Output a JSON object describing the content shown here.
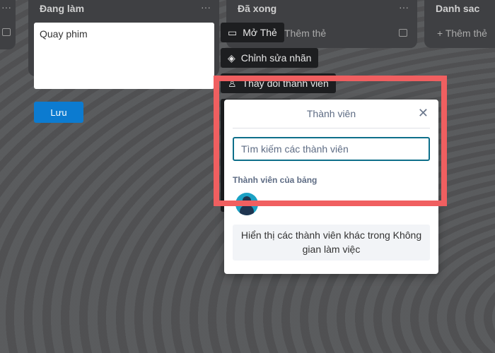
{
  "lists": [
    {
      "title": "Đang làm"
    },
    {
      "title": "Đã xong",
      "add_card": "Thêm thẻ"
    },
    {
      "title": "Danh sac",
      "add_card": "+ Thêm thẻ"
    }
  ],
  "card_editor": {
    "value": "Quay phim",
    "save_label": "Lưu"
  },
  "quick_actions": [
    {
      "label": "Mở Thẻ",
      "icon": "card-icon"
    },
    {
      "label": "Chỉnh sửa nhãn",
      "icon": "tag-icon"
    },
    {
      "label": "Thay đổi thành viên",
      "icon": "person-icon"
    }
  ],
  "members_popup": {
    "title": "Thành viên",
    "search_placeholder": "Tìm kiếm các thành viên",
    "section_label": "Thành viên của bảng",
    "show_more_label": "Hiển thị các thành viên khác trong Không gian làm việc"
  },
  "colors": {
    "save": "#0c7bd0",
    "highlight": "#f05f60",
    "search_border": "#0e6f8a"
  }
}
